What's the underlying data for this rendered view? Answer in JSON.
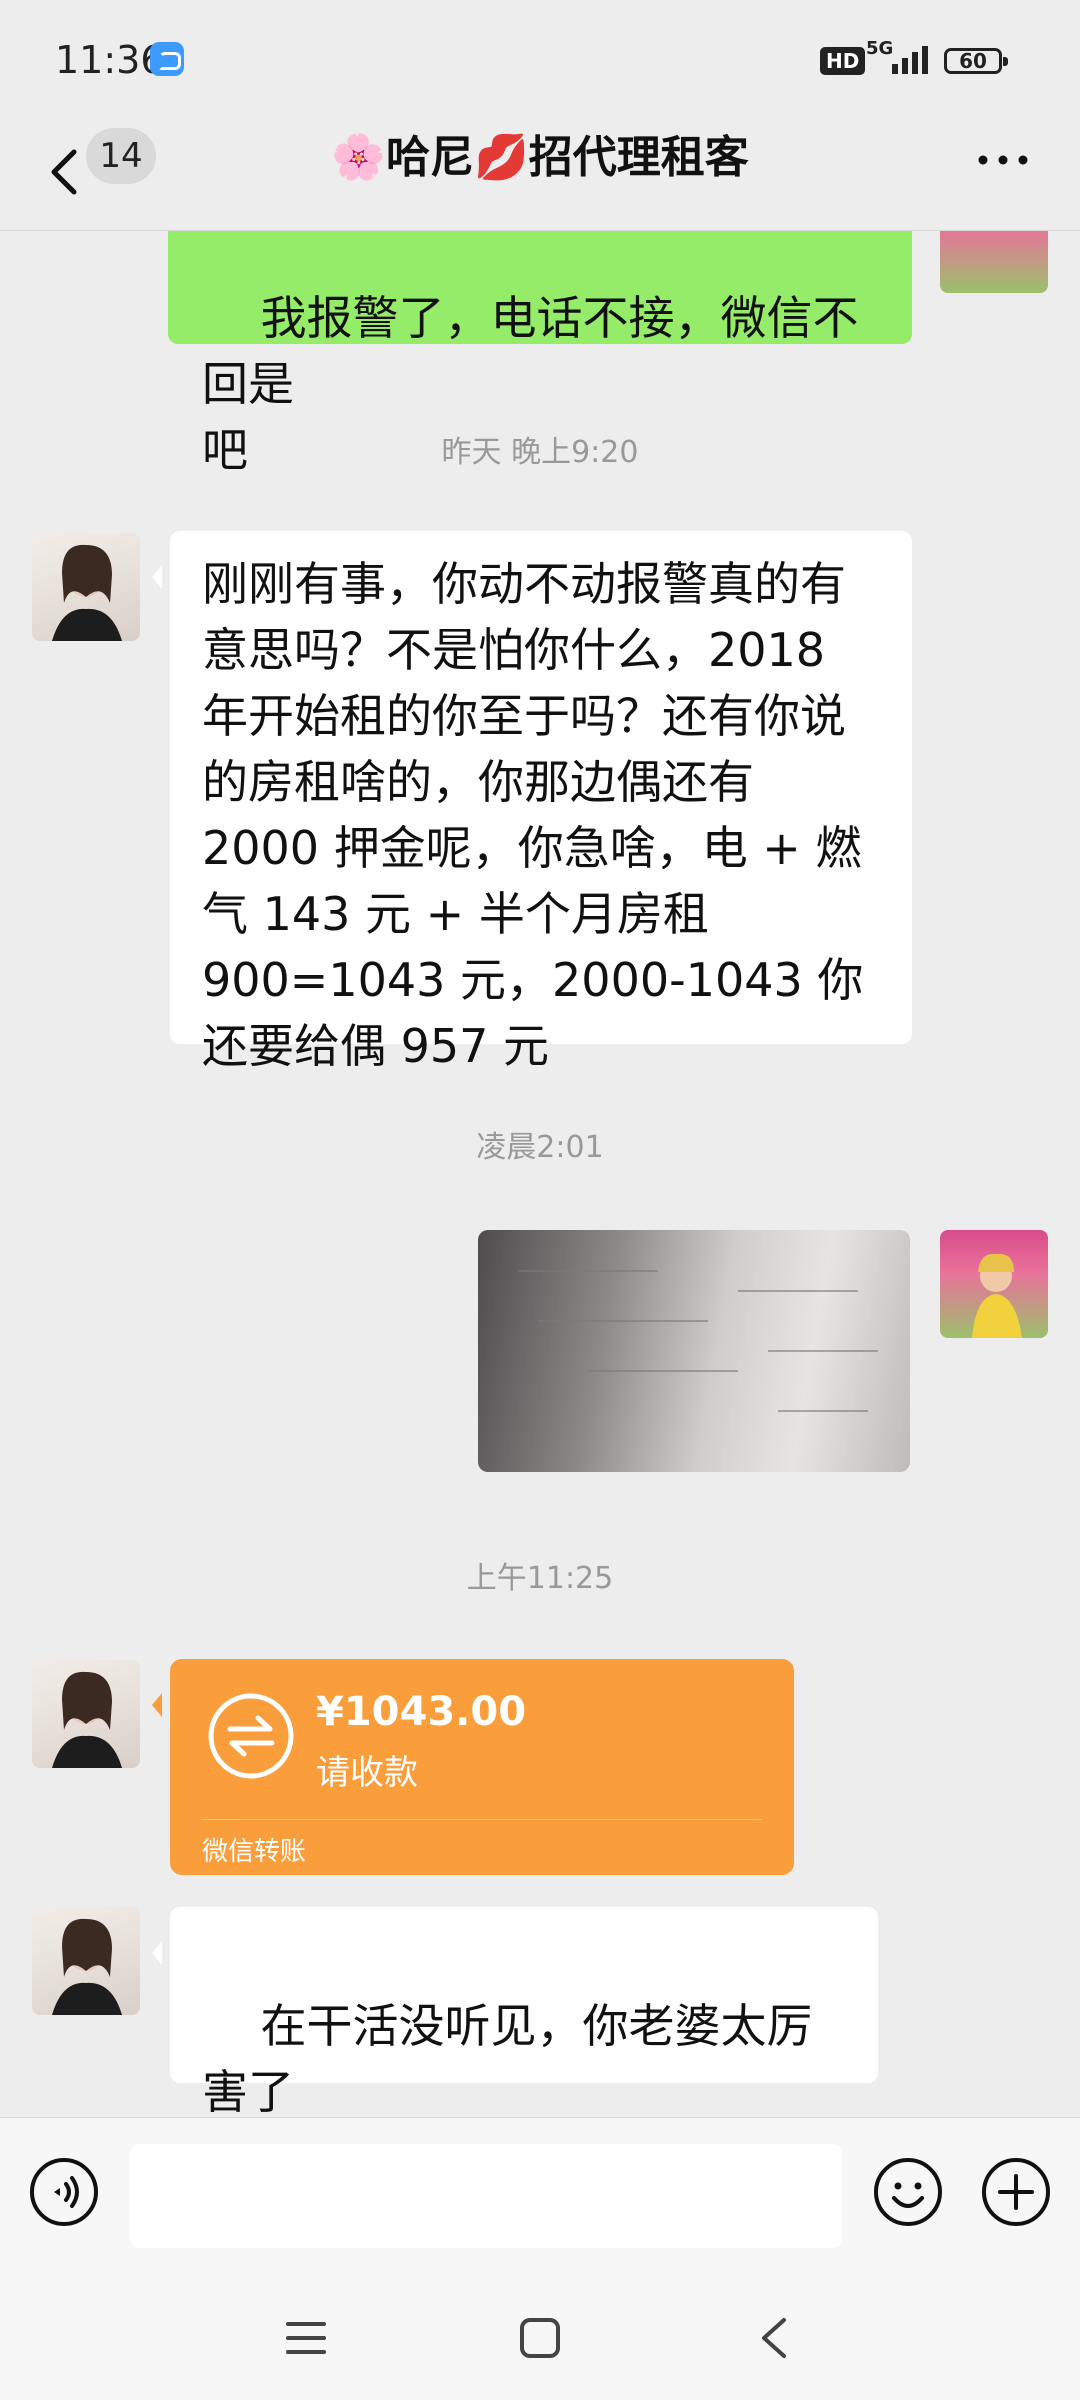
{
  "status_bar": {
    "time": "11:36",
    "network": "5G",
    "hd": "HD",
    "battery": "60"
  },
  "header": {
    "unread_count": "14",
    "title": "🌸哈尼💋招代理租客"
  },
  "messages": {
    "m0_text": "我报警了，电话不接，微信不回是\n吧",
    "sep1": "昨天 晚上9:20",
    "m1_text": "刚刚有事，你动不动报警真的有意思吗？不是怕你什么，2018 年开始租的你至于吗？还有你说的房租啥的，你那边偶还有 2000 押金呢，你急啥，电 + 燃气 143 元 + 半个月房租 900=1043 元，2000-1043 你还要给偶 957 元",
    "sep2": "凌晨2:01",
    "sep3": "上午11:25",
    "transfer": {
      "amount": "¥1043.00",
      "status": "请收款",
      "footer": "微信转账"
    },
    "m4_text": "在干活没听见，你老婆太厉害了\n👍"
  },
  "input": {
    "placeholder": ""
  },
  "colors": {
    "background": "#ededed",
    "outgoing_bubble": "#95ec69",
    "incoming_bubble": "#ffffff",
    "transfer_card": "#fa9d3b"
  },
  "icons": {
    "back": "chevron-left-icon",
    "more": "more-dots-icon",
    "voice": "voice-icon",
    "emoji": "emoji-icon",
    "plus": "plus-icon"
  }
}
